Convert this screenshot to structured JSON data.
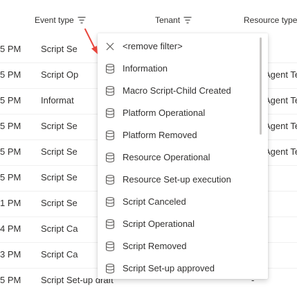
{
  "header": {
    "event_type_label": "Event type",
    "tenant_label": "Tenant",
    "resource_type_label": "Resource type"
  },
  "rows": [
    {
      "time": "5 PM",
      "type": "Script Se",
      "res": ""
    },
    {
      "time": "5 PM",
      "type": "Script Op",
      "res": "Agent Te"
    },
    {
      "time": "5 PM",
      "type": "Informat",
      "res": "Agent Te"
    },
    {
      "time": "5 PM",
      "type": "Script Se",
      "res": "Agent Te"
    },
    {
      "time": "5 PM",
      "type": "Script Se",
      "res": "Agent Te"
    },
    {
      "time": "5 PM",
      "type": "Script Se",
      "res": ""
    },
    {
      "time": "1 PM",
      "type": "Script Se",
      "res": ""
    },
    {
      "time": "4 PM",
      "type": "Script Ca",
      "res": ""
    },
    {
      "time": "3 PM",
      "type": "Script Ca",
      "res": ""
    },
    {
      "time": "5 PM",
      "type": "Script Set-up draft",
      "res": "-"
    }
  ],
  "dropdown": {
    "remove_filter": "<remove filter>",
    "options": [
      "Information",
      "Macro Script-Child Created",
      "Platform Operational",
      "Platform Removed",
      "Resource Operational",
      "Resource Set-up execution",
      "Script Canceled",
      "Script Operational",
      "Script Removed",
      "Script Set-up approved"
    ]
  },
  "colors": {
    "annotation_arrow": "#e8453c",
    "text": "#323130",
    "icon": "#605e5c"
  },
  "icons": {
    "filter": "filter-icon",
    "remove": "close-icon",
    "option": "database-icon"
  }
}
